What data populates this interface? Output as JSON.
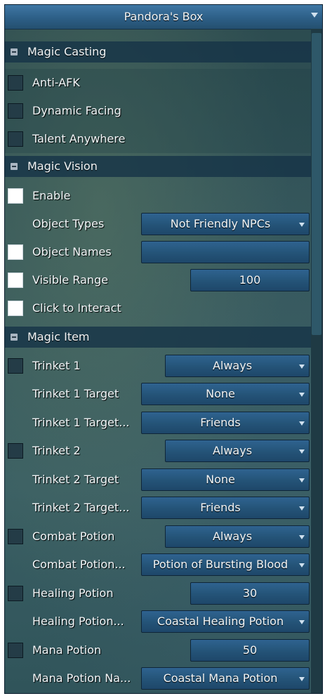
{
  "window": {
    "title": "Pandora's Box"
  },
  "magic_casting": {
    "title": "Magic Casting",
    "anti_afk": "Anti-AFK",
    "dynamic_facing": "Dynamic Facing",
    "talent_anywhere": "Talent Anywhere"
  },
  "magic_vision": {
    "title": "Magic Vision",
    "enable": "Enable",
    "object_types_label": "Object Types",
    "object_types_value": "Not Friendly NPCs",
    "object_names_label": "Object Names",
    "object_names_value": "",
    "visible_range_label": "Visible Range",
    "visible_range_value": "100",
    "click_to_interact": "Click to Interact"
  },
  "magic_item": {
    "title": "Magic Item",
    "trinket1_label": "Trinket 1",
    "trinket1_value": "Always",
    "trinket1_target_label": "Trinket 1 Target",
    "trinket1_target_value": "None",
    "trinket1_target2_label": "Trinket 1 Target...",
    "trinket1_target2_value": "Friends",
    "trinket2_label": "Trinket 2",
    "trinket2_value": "Always",
    "trinket2_target_label": "Trinket 2 Target",
    "trinket2_target_value": "None",
    "trinket2_target2_label": "Trinket 2 Target...",
    "trinket2_target2_value": "Friends",
    "combat_potion_label": "Combat Potion",
    "combat_potion_value": "Always",
    "combat_potion_name_label": "Combat Potion...",
    "combat_potion_name_value": "Potion of Bursting Blood",
    "healing_potion_label": "Healing Potion",
    "healing_potion_value": "30",
    "healing_potion_name_label": "Healing Potion...",
    "healing_potion_name_value": "Coastal Healing Potion",
    "mana_potion_label": "Mana Potion",
    "mana_potion_value": "50",
    "mana_potion_name_label": "Mana Potion Na...",
    "mana_potion_name_value": "Coastal Mana Potion"
  }
}
